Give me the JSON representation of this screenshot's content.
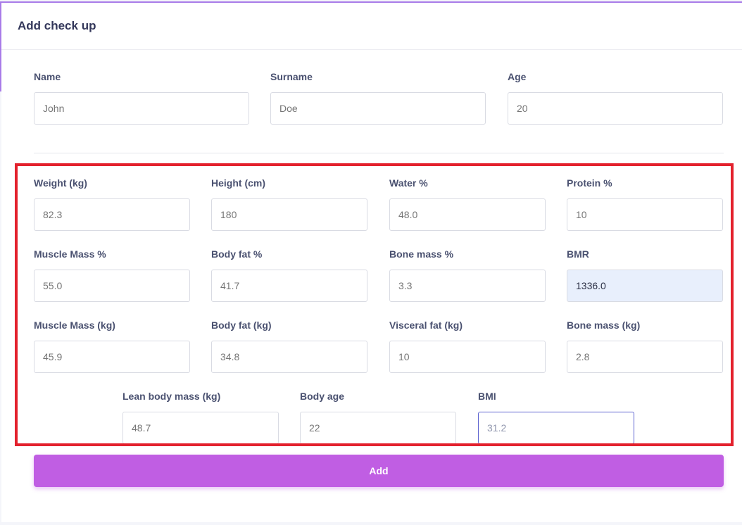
{
  "header": {
    "title": "Add check up"
  },
  "personal": {
    "name": {
      "label": "Name",
      "placeholder": "John"
    },
    "surname": {
      "label": "Surname",
      "placeholder": "Doe"
    },
    "age": {
      "label": "Age",
      "placeholder": "20"
    }
  },
  "metrics": {
    "weight": {
      "label": "Weight (kg)",
      "placeholder": "82.3"
    },
    "height": {
      "label": "Height (cm)",
      "placeholder": "180"
    },
    "water": {
      "label": "Water %",
      "placeholder": "48.0"
    },
    "protein": {
      "label": "Protein %",
      "placeholder": "10"
    },
    "muscle_pct": {
      "label": "Muscle Mass %",
      "placeholder": "55.0"
    },
    "fat_pct": {
      "label": "Body fat %",
      "placeholder": "41.7"
    },
    "bone_pct": {
      "label": "Bone mass %",
      "placeholder": "3.3"
    },
    "bmr": {
      "label": "BMR",
      "value": "1336.0"
    },
    "muscle_kg": {
      "label": "Muscle Mass (kg)",
      "placeholder": "45.9"
    },
    "fat_kg": {
      "label": "Body fat (kg)",
      "placeholder": "34.8"
    },
    "visceral": {
      "label": "Visceral fat (kg)",
      "placeholder": "10"
    },
    "bone_kg": {
      "label": "Bone mass (kg)",
      "placeholder": "2.8"
    },
    "lean": {
      "label": "Lean body mass (kg)",
      "placeholder": "48.7"
    },
    "body_age": {
      "label": "Body age",
      "placeholder": "22"
    },
    "bmi": {
      "label": "BMI",
      "value": "31.2"
    }
  },
  "actions": {
    "add_label": "Add"
  },
  "colors": {
    "accent": "#c05ee3",
    "highlight_box": "#e3212d",
    "autofill_bg": "#e8effc"
  }
}
